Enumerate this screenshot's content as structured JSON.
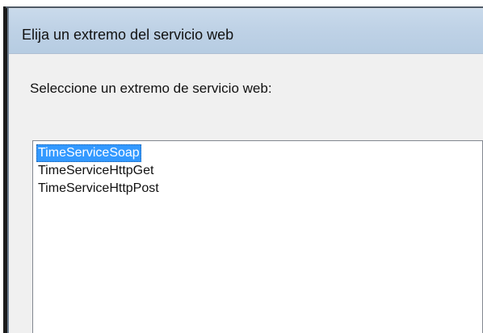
{
  "dialog": {
    "title": "Elija un extremo del servicio web",
    "prompt": "Seleccione un extremo de servicio web:"
  },
  "endpoint_list": {
    "items": [
      {
        "label": "TimeServiceSoap",
        "selected": true
      },
      {
        "label": "TimeServiceHttpGet",
        "selected": false
      },
      {
        "label": "TimeServiceHttpPost",
        "selected": false
      }
    ]
  },
  "colors": {
    "selection_background": "#3399ff",
    "selection_text": "#ffffff",
    "titlebar_background": "#bfd2e6",
    "window_background": "#f0f0f0"
  }
}
